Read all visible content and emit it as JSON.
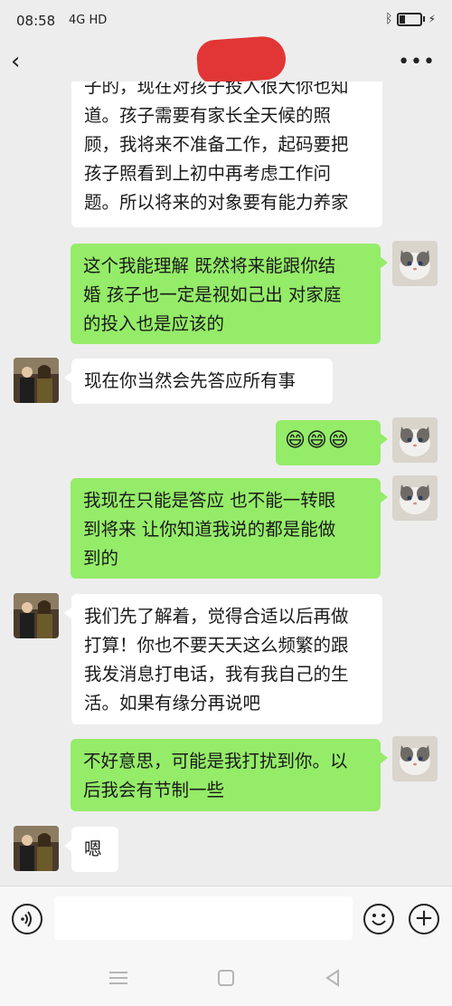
{
  "status": {
    "time": "08:58",
    "signal": "4G HD"
  },
  "nav": {
    "back_glyph": "‹",
    "more_glyph": "•••"
  },
  "messages": [
    {
      "side": "in",
      "lines": [
        "子的，现在对孩子投入很大你也知",
        "道。孩子需要有家长全天候的照",
        "顾，我将来不准备工作，起码要把",
        "孩子照看到上初中再考虑工作问",
        "题。所以将来的对象要有能力养家"
      ]
    },
    {
      "side": "out",
      "lines": [
        "这个我能理解 既然将来能跟你结",
        "婚 孩子也一定是视如己出 对家庭",
        "的投入也是应该的"
      ]
    },
    {
      "side": "in",
      "lines": [
        "现在你当然会先答应所有事"
      ]
    },
    {
      "side": "out",
      "text": "😄😄😄"
    },
    {
      "side": "out",
      "lines": [
        "我现在只能是答应 也不能一转眼",
        "到将来 让你知道我说的都是能做",
        "到的"
      ]
    },
    {
      "side": "in",
      "lines": [
        "我们先了解着，觉得合适以后再做",
        "打算！你也不要天天这么频繁的跟",
        "我发消息打电话，我有我自己的生",
        "活。如果有缘分再说吧"
      ]
    },
    {
      "side": "out",
      "lines": [
        "不好意思，可能是我打扰到你。以",
        "后我会有节制一些"
      ]
    },
    {
      "side": "in",
      "lines": [
        "嗯"
      ]
    }
  ],
  "input": {
    "placeholder": ""
  },
  "colors": {
    "outgoing_bubble": "#95ec69",
    "incoming_bubble": "#ffffff",
    "background": "#ededed"
  },
  "icons": {
    "voice": "voice-icon",
    "emoji": "emoji-icon",
    "plus": "plus-icon",
    "menu": "menu-icon",
    "home": "home-icon",
    "back": "back-triangle-icon"
  }
}
